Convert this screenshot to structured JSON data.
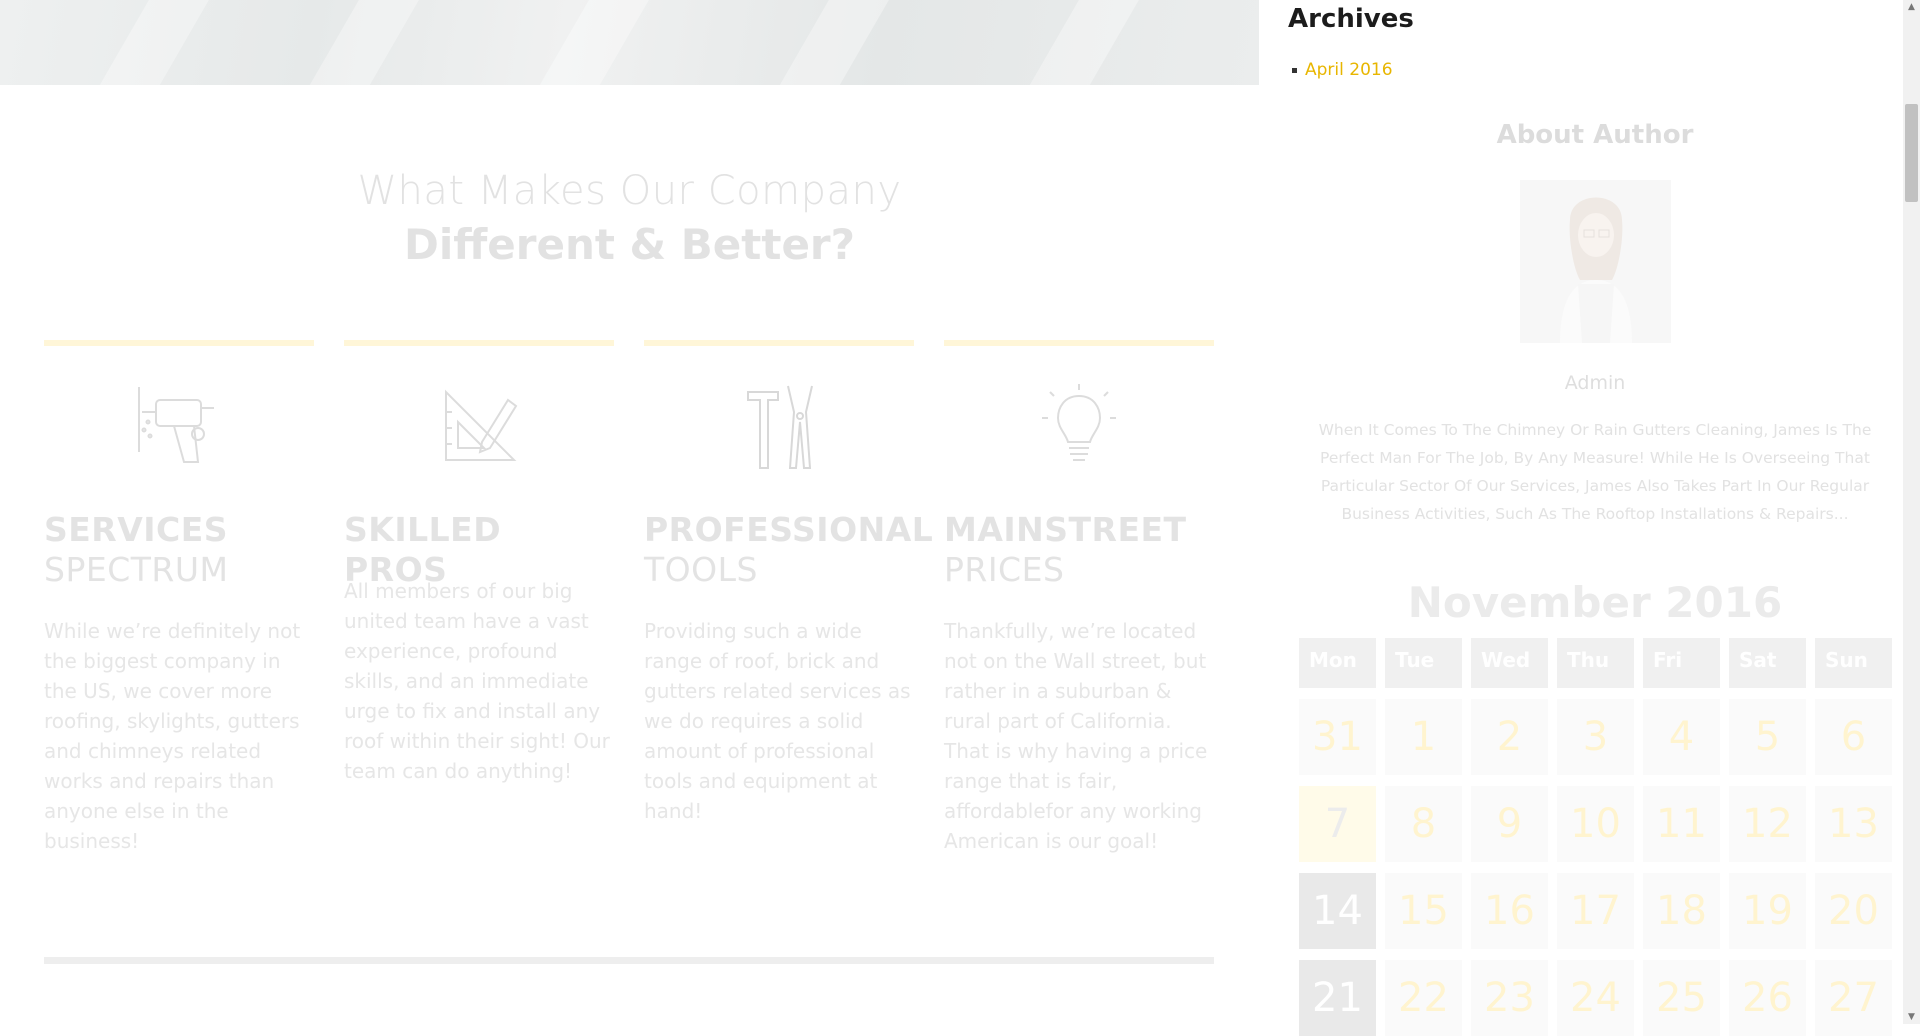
{
  "heading": {
    "line1": "What Makes Our Company",
    "line2": "Different & Better?"
  },
  "features": [
    {
      "icon": "drill-icon",
      "title_bold": "SERVICES",
      "title_light": "SPECTRUM",
      "text": "While we’re definitely not the biggest company in the US, we cover more roofing, skylights, gutters and chimneys related works and repairs than anyone else in the business!"
    },
    {
      "icon": "ruler-pencil-icon",
      "title_bold": "SKILLED PROS",
      "title_light": "",
      "text": "All members of our big united team have a vast experience, profound skills, and an immediate urge to fix and install any roof within their sight! Our team can do anything!"
    },
    {
      "icon": "hammer-pliers-icon",
      "title_bold": "PROFESSIONAL",
      "title_light": "TOOLS",
      "text": "Providing such a wide range of roof, brick and gutters related services as we do requires a solid amount of professional tools and equipment at hand!"
    },
    {
      "icon": "lightbulb-icon",
      "title_bold": "MAINSTREET",
      "title_light": "PRICES",
      "text": "Thankfully, we’re located not on the Wall street, but rather in a suburban & rural part of California. That is why having a price range that is fair, affordablefor any working American is our goal!"
    }
  ],
  "sidebar": {
    "archives_title": "Archives",
    "archives": [
      "April 2016"
    ],
    "about_title": "About Author",
    "author_name": "Admin",
    "author_bio": "When It Comes To The Chimney Or Rain Gutters Cleaning, James Is The Perfect Man For The Job, By Any Measure! While He Is Overseeing That Particular Sector Of Our Services, James Also Takes Part In Our Regular Business Activities, Such As The Rooftop Installations & Repairs..."
  },
  "calendar": {
    "title": "November 2016",
    "weekdays": [
      "Mon",
      "Tue",
      "Wed",
      "Thu",
      "Fri",
      "Sat",
      "Sun"
    ],
    "weeks": [
      [
        "31",
        "1",
        "2",
        "3",
        "4",
        "5",
        "6"
      ],
      [
        "7",
        "8",
        "9",
        "10",
        "11",
        "12",
        "13"
      ],
      [
        "14",
        "15",
        "16",
        "17",
        "18",
        "19",
        "20"
      ],
      [
        "21",
        "22",
        "23",
        "24",
        "25",
        "26",
        "27"
      ]
    ],
    "today": "7"
  },
  "colors": {
    "accent": "#e8b600",
    "feature_bar": "#fff6d8"
  }
}
